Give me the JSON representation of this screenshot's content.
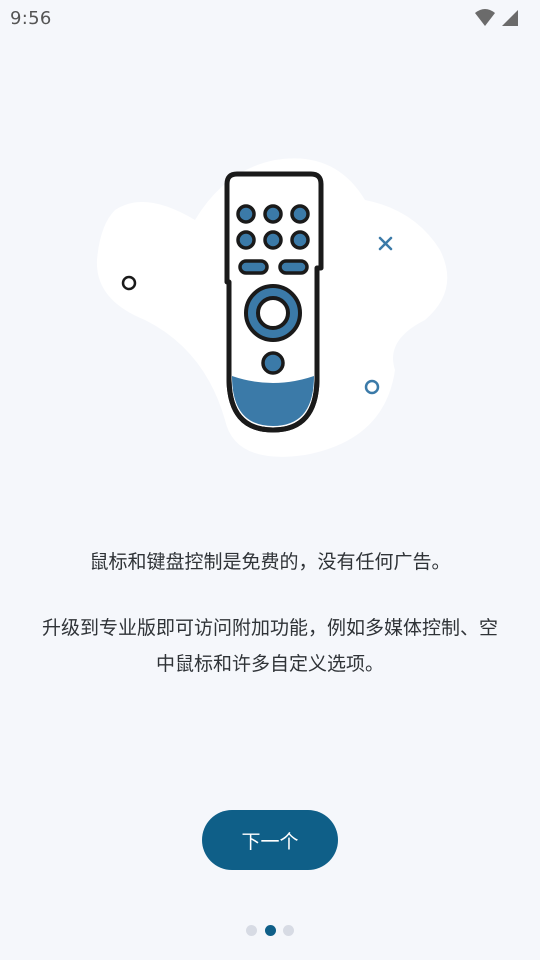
{
  "status_bar": {
    "time": "9:56",
    "icons": [
      "wifi-icon",
      "cellular-signal-icon"
    ]
  },
  "illustration": {
    "name": "remote-control-illustration",
    "accent_color": "#3b7aa8",
    "outline_color": "#1a1a1a"
  },
  "content": {
    "line1": "鼠标和键盘控制是免费的，没有任何广告。",
    "line2": "升级到专业版即可访问附加功能，例如多媒体控制、空中鼠标和许多自定义选项。"
  },
  "actions": {
    "next_label": "下一个"
  },
  "pager": {
    "total_pages": 3,
    "current_page": 2
  },
  "colors": {
    "background": "#f5f7fb",
    "primary": "#0f5f88",
    "dot_inactive": "#d7dbe4"
  }
}
